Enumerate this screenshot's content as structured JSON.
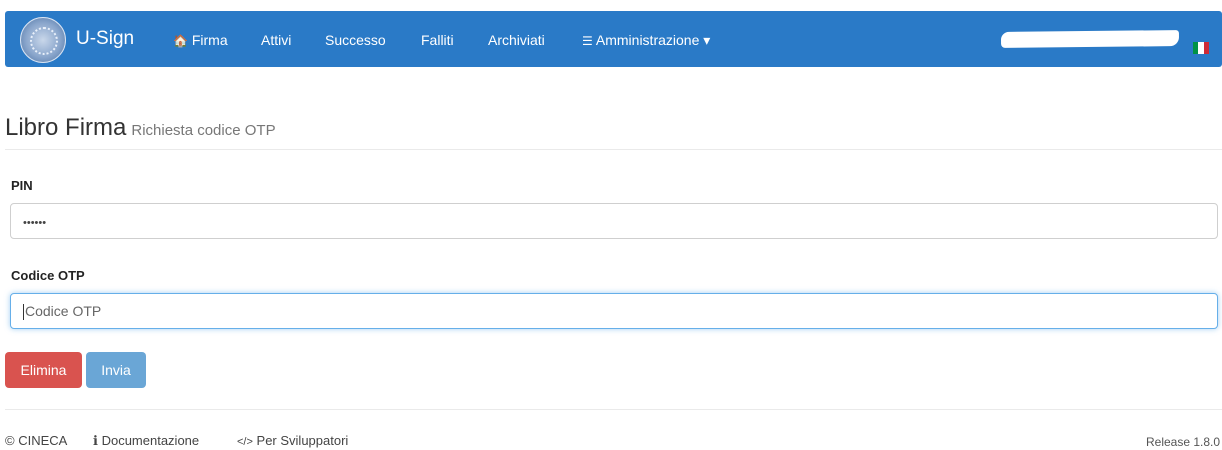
{
  "navbar": {
    "brand": "U-Sign",
    "items": [
      {
        "icon": "home-icon",
        "glyph": "🏠",
        "label": "Firma"
      },
      {
        "label": "Attivi"
      },
      {
        "label": "Successo"
      },
      {
        "label": "Falliti"
      },
      {
        "label": "Archiviati"
      },
      {
        "icon": "sliders-icon",
        "glyph": "☰",
        "label": "Amministrazione",
        "dropdown": "▾"
      }
    ],
    "flag_colors": [
      "#009246",
      "#ffffff",
      "#ce2b37"
    ]
  },
  "page": {
    "title": "Libro Firma",
    "subtitle": "Richiesta codice OTP"
  },
  "form": {
    "pin_label": "PIN",
    "pin_value": "••••••",
    "otp_label": "Codice OTP",
    "otp_placeholder": "Codice OTP"
  },
  "buttons": {
    "delete": "Elimina",
    "submit": "Invia"
  },
  "footer": {
    "copyright_glyph": "©",
    "copyright": "CINECA",
    "doc_glyph": "ℹ",
    "docs": "Documentazione",
    "dev_glyph": "</>",
    "devs": "Per Sviluppatori",
    "release": "Release 1.8.0"
  }
}
